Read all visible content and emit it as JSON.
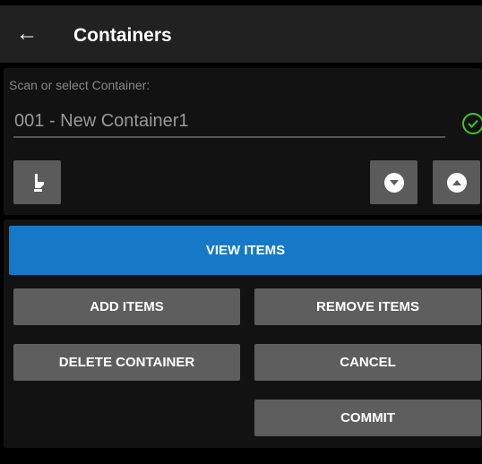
{
  "header": {
    "title": "Containers",
    "back_icon": "arrow-left-icon"
  },
  "scan": {
    "label": "Scan or select Container:",
    "value": "001 - New Container1",
    "status_color": "#3ec81e"
  },
  "toolbar": {
    "pick_icon": "hand-pointer-icon",
    "down_icon": "circle-chevron-down-icon",
    "up_icon": "circle-chevron-up-icon"
  },
  "actions": {
    "view": "VIEW ITEMS",
    "add": "ADD ITEMS",
    "remove": "REMOVE ITEMS",
    "delete": "DELETE CONTAINER",
    "cancel": "CANCEL",
    "commit": "COMMIT"
  },
  "colors": {
    "accent": "#1579c8",
    "button": "#5e5e5e"
  }
}
